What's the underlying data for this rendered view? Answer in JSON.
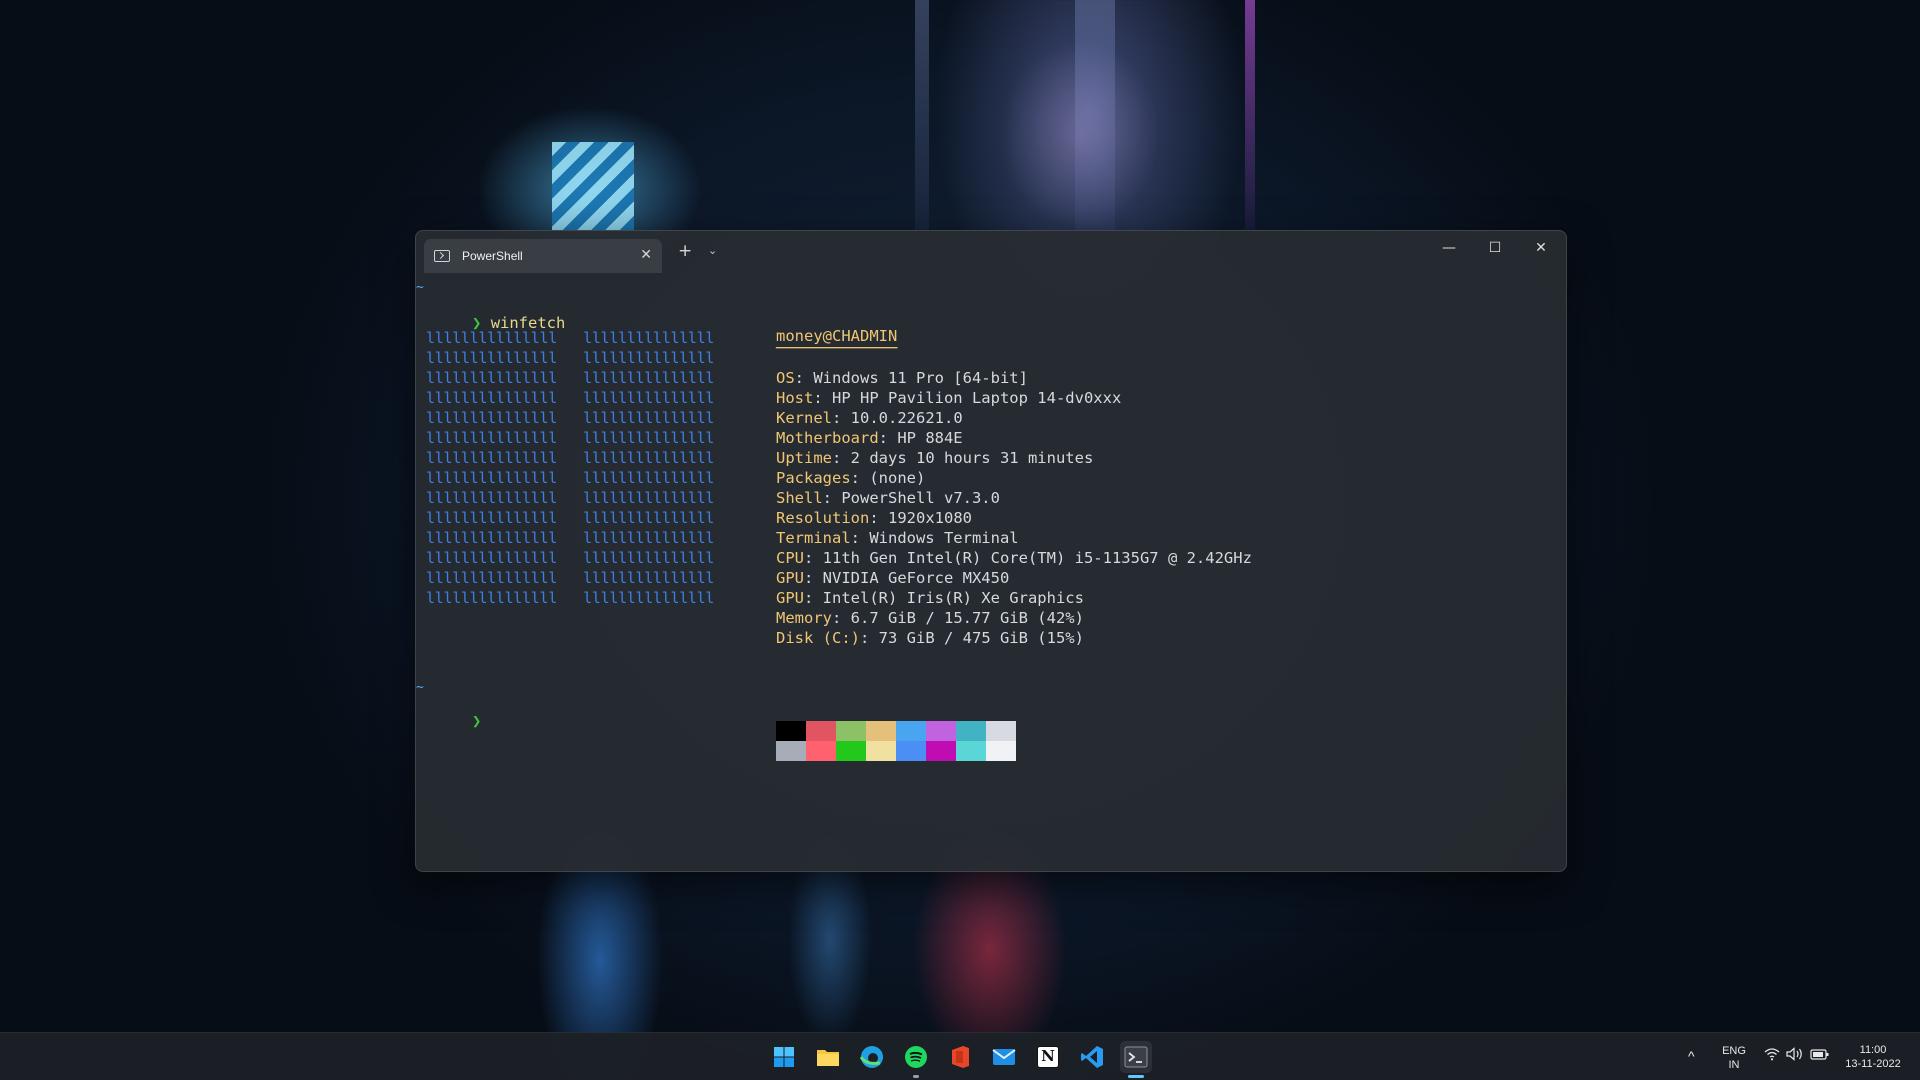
{
  "window": {
    "tab_title": "PowerShell",
    "tab_close": "✕",
    "new_tab": "+",
    "dropdown": "⌄",
    "minimize": "—",
    "maximize": "☐",
    "close": "✕"
  },
  "terminal": {
    "tilde": "~",
    "prompt_symbol": "❯",
    "command": "winfetch",
    "logo_block": "lllllllllllllll   lllllllllllllll",
    "user_host": "money@CHADMIN",
    "separator": "─────────────",
    "info": [
      {
        "key": "OS",
        "value": ": Windows 11 Pro [64-bit]"
      },
      {
        "key": "Host",
        "value": ": HP HP Pavilion Laptop 14-dv0xxx"
      },
      {
        "key": "Kernel",
        "value": ": 10.0.22621.0"
      },
      {
        "key": "Motherboard",
        "value": ": HP 884E"
      },
      {
        "key": "Uptime",
        "value": ": 2 days 10 hours 31 minutes"
      },
      {
        "key": "Packages",
        "value": ": (none)"
      },
      {
        "key": "Shell",
        "value": ": PowerShell v7.3.0"
      },
      {
        "key": "Resolution",
        "value": ": 1920x1080"
      },
      {
        "key": "Terminal",
        "value": ": Windows Terminal"
      },
      {
        "key": "CPU",
        "value": ": 11th Gen Intel(R) Core(TM) i5-1135G7 @ 2.42GHz"
      },
      {
        "key": "GPU",
        "value": ": NVIDIA GeForce MX450"
      },
      {
        "key": "GPU",
        "value": ": Intel(R) Iris(R) Xe Graphics"
      },
      {
        "key": "Memory",
        "value": ": 6.7 GiB / 15.77 GiB (42%)"
      },
      {
        "key": "Disk (C:)",
        "value": ": 73 GiB / 475 GiB (15%)"
      }
    ],
    "palette_top": [
      "#000000",
      "#e05561",
      "#8cc265",
      "#e5c07b",
      "#4aa5f0",
      "#c162de",
      "#42b3c2",
      "#d7dae0"
    ],
    "palette_bottom": [
      "#a7adb8",
      "#ff616e",
      "#22c91b",
      "#f0e1a0",
      "#4b8ff5",
      "#c00cb3",
      "#5ad6d6",
      "#f0f2f5"
    ]
  },
  "taskbar": {
    "apps": [
      {
        "name": "start-button",
        "icon": "windows-icon"
      },
      {
        "name": "file-explorer-button",
        "icon": "folder-icon"
      },
      {
        "name": "edge-button",
        "icon": "edge-icon"
      },
      {
        "name": "spotify-button",
        "icon": "spotify-icon"
      },
      {
        "name": "office-button",
        "icon": "office-icon"
      },
      {
        "name": "mail-button",
        "icon": "mail-icon"
      },
      {
        "name": "notion-button",
        "icon": "notion-icon",
        "label": "N"
      },
      {
        "name": "vscode-button",
        "icon": "vscode-icon"
      },
      {
        "name": "terminal-button",
        "icon": "terminal-icon"
      }
    ],
    "tray": {
      "chevron": "^",
      "lang_top": "ENG",
      "lang_bottom": "IN",
      "time": "11:00",
      "date": "13-11-2022"
    }
  }
}
